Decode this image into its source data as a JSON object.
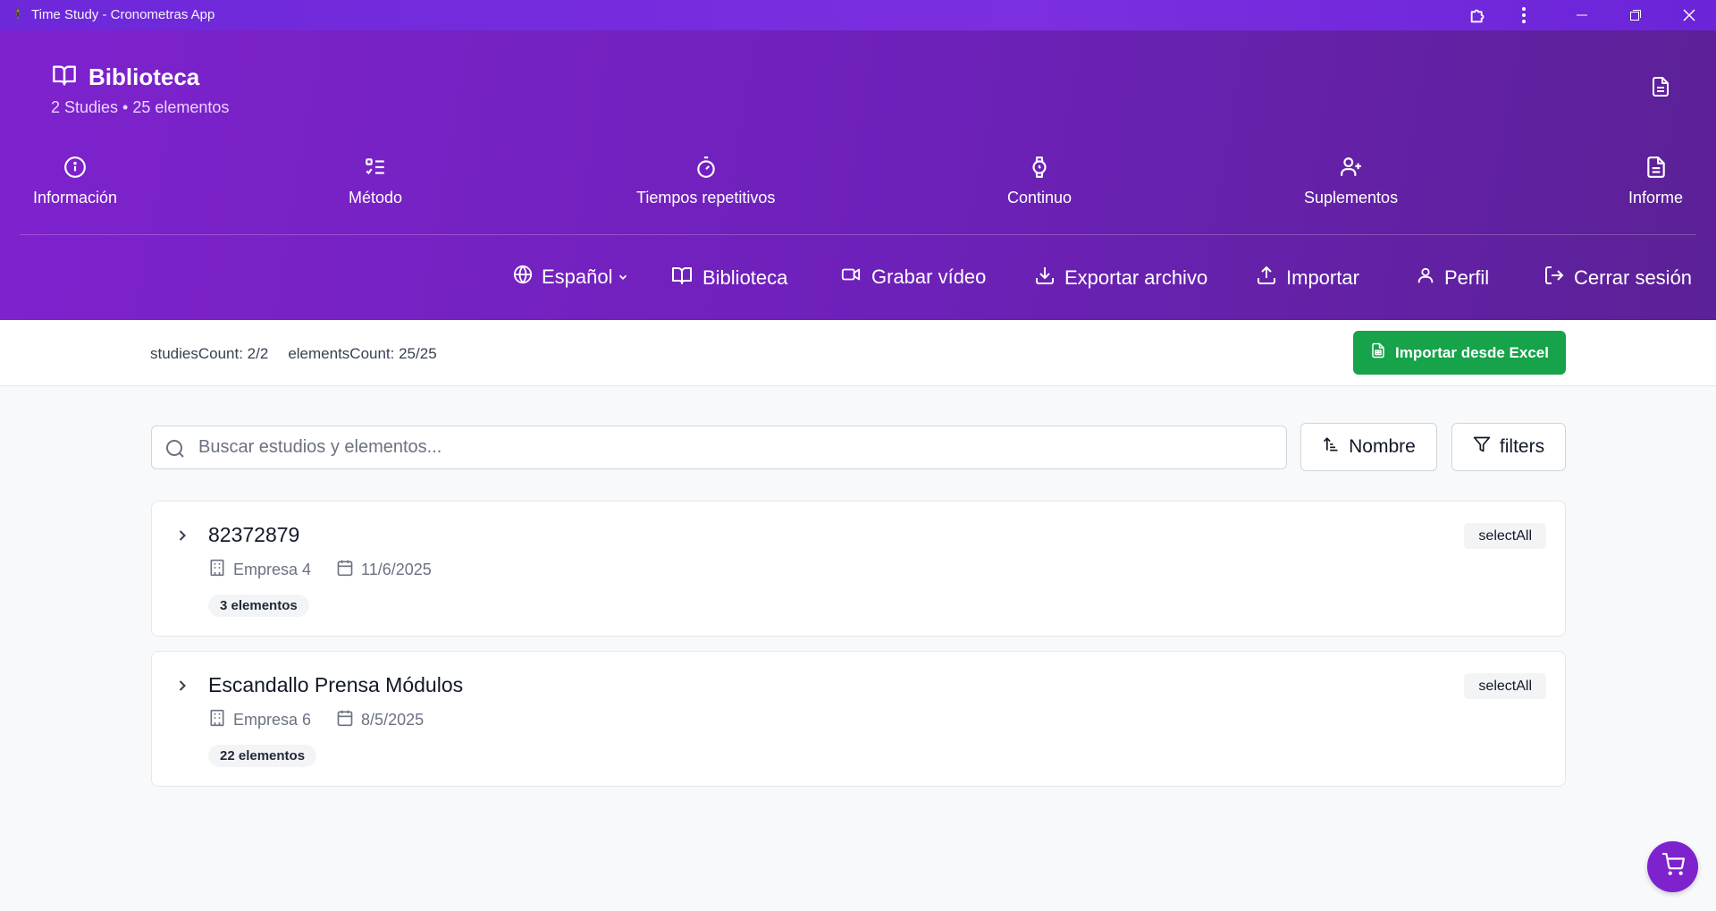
{
  "window": {
    "title": "Time Study - Cronometras App"
  },
  "header": {
    "title": "Biblioteca",
    "subtitle": "2 Studies • 25 elementos"
  },
  "tabs": [
    {
      "label": "Información",
      "icon": "info-icon"
    },
    {
      "label": "Método",
      "icon": "list-checks-icon"
    },
    {
      "label": "Tiempos repetitivos",
      "icon": "timer-icon"
    },
    {
      "label": "Continuo",
      "icon": "watch-icon"
    },
    {
      "label": "Suplementos",
      "icon": "user-plus-icon"
    },
    {
      "label": "Informe",
      "icon": "document-icon"
    }
  ],
  "actions": {
    "language": "Español",
    "library": "Biblioteca",
    "record_video": "Grabar vídeo",
    "export": "Exportar archivo",
    "import": "Importar",
    "profile": "Perfil",
    "logout": "Cerrar sesión"
  },
  "status": {
    "studies_count": "studiesCount: 2/2",
    "elements_count": "elementsCount: 25/25",
    "import_excel": "Importar desde Excel"
  },
  "search": {
    "placeholder": "Buscar estudios y elementos...",
    "value": ""
  },
  "sort": {
    "label": "Nombre"
  },
  "filters": {
    "label": "filters"
  },
  "studies": [
    {
      "name": "82372879",
      "company": "Empresa 4",
      "date": "11/6/2025",
      "elements": "3 elementos",
      "select_all": "selectAll"
    },
    {
      "name": "Escandallo Prensa Módulos",
      "company": "Empresa 6",
      "date": "8/5/2025",
      "elements": "22 elementos",
      "select_all": "selectAll"
    }
  ],
  "colors": {
    "header_gradient_start": "#7e22ce",
    "header_gradient_end": "#5b2196",
    "excel_button": "#16a34a",
    "cart_button": "#7e22ce"
  }
}
